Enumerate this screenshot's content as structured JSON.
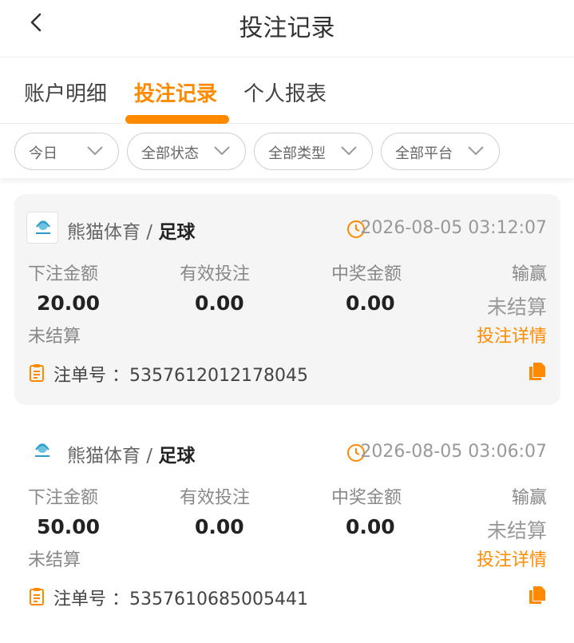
{
  "header": {
    "title": "投注记录"
  },
  "tabs": [
    {
      "label": "账户明细"
    },
    {
      "label": "投注记录"
    },
    {
      "label": "个人报表"
    }
  ],
  "filters": [
    {
      "label": "今日"
    },
    {
      "label": "全部状态"
    },
    {
      "label": "全部类型"
    },
    {
      "label": "全部平台"
    }
  ],
  "labels": {
    "stake": "下注金额",
    "valid": "有效投注",
    "win": "中奖金额",
    "winloss": "输赢",
    "detail": "投注详情",
    "order_prefix": "注单号 ："
  },
  "bets": [
    {
      "platform": "熊猫体育 / ",
      "sport": "足球",
      "time": "2026-08-05 03:12:07",
      "stake": "20.00",
      "valid": "0.00",
      "win": "0.00",
      "result": "未结算",
      "status": "未结算",
      "order_no": "5357612012178045"
    },
    {
      "platform": "熊猫体育 / ",
      "sport": "足球",
      "time": "2026-08-05 03:06:07",
      "stake": "50.00",
      "valid": "0.00",
      "win": "0.00",
      "result": "未结算",
      "status": "未结算",
      "order_no": "5357610685005441"
    }
  ],
  "colors": {
    "accent": "#ff8a00",
    "card_bg": "#f5f5f5"
  }
}
